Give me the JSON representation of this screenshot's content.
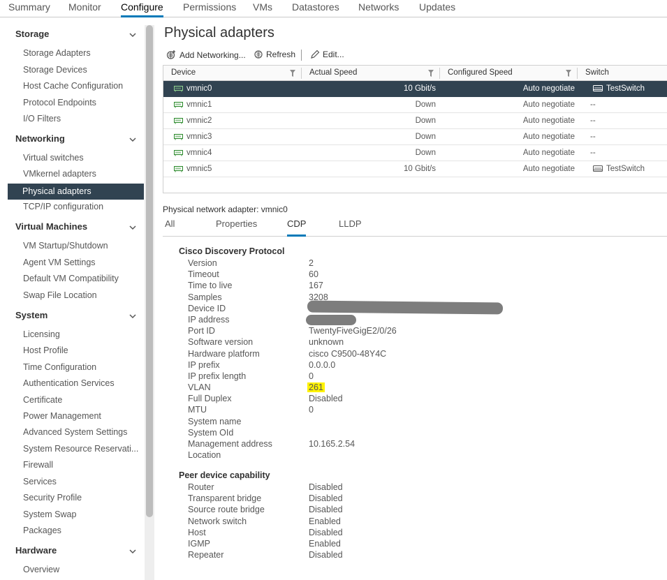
{
  "top_tabs": [
    "Summary",
    "Monitor",
    "Configure",
    "Permissions",
    "VMs",
    "Datastores",
    "Networks",
    "Updates"
  ],
  "sidebar": {
    "sections": [
      {
        "title": "Storage",
        "items": [
          "Storage Adapters",
          "Storage Devices",
          "Host Cache Configuration",
          "Protocol Endpoints",
          "I/O Filters"
        ]
      },
      {
        "title": "Networking",
        "items": [
          "Virtual switches",
          "VMkernel adapters",
          "Physical adapters",
          "TCP/IP configuration"
        ]
      },
      {
        "title": "Virtual Machines",
        "items": [
          "VM Startup/Shutdown",
          "Agent VM Settings",
          "Default VM Compatibility",
          "Swap File Location"
        ]
      },
      {
        "title": "System",
        "items": [
          "Licensing",
          "Host Profile",
          "Time Configuration",
          "Authentication Services",
          "Certificate",
          "Power Management",
          "Advanced System Settings",
          "System Resource Reservati...",
          "Firewall",
          "Services",
          "Security Profile",
          "System Swap",
          "Packages"
        ]
      },
      {
        "title": "Hardware",
        "items": [
          "Overview"
        ]
      }
    ],
    "active_item": "Physical adapters"
  },
  "main": {
    "title": "Physical adapters",
    "toolbar": {
      "add": "Add Networking...",
      "refresh": "Refresh",
      "edit": "Edit..."
    },
    "grid": {
      "columns": [
        "Device",
        "Actual Speed",
        "Configured Speed",
        "Switch"
      ],
      "rows": [
        {
          "device": "vmnic0",
          "actual": "10 Gbit/s",
          "configured": "Auto negotiate",
          "switch": "TestSwitch",
          "has_switch": true,
          "selected": true
        },
        {
          "device": "vmnic1",
          "actual": "Down",
          "configured": "Auto negotiate",
          "switch": "--",
          "has_switch": false,
          "selected": false
        },
        {
          "device": "vmnic2",
          "actual": "Down",
          "configured": "Auto negotiate",
          "switch": "--",
          "has_switch": false,
          "selected": false
        },
        {
          "device": "vmnic3",
          "actual": "Down",
          "configured": "Auto negotiate",
          "switch": "--",
          "has_switch": false,
          "selected": false
        },
        {
          "device": "vmnic4",
          "actual": "Down",
          "configured": "Auto negotiate",
          "switch": "--",
          "has_switch": false,
          "selected": false
        },
        {
          "device": "vmnic5",
          "actual": "10 Gbit/s",
          "configured": "Auto negotiate",
          "switch": "TestSwitch",
          "has_switch": true,
          "selected": false
        }
      ]
    },
    "detail_title": "Physical network adapter: vmnic0",
    "sub_tabs": [
      "All",
      "Properties",
      "CDP",
      "LLDP"
    ],
    "active_sub_tab": "CDP",
    "cdp": {
      "title": "Cisco Discovery Protocol",
      "fields": [
        {
          "key": "Version",
          "value": "2"
        },
        {
          "key": "Timeout",
          "value": "60"
        },
        {
          "key": "Time to live",
          "value": "167"
        },
        {
          "key": "Samples",
          "value": "3208"
        },
        {
          "key": "Device ID",
          "value": ""
        },
        {
          "key": "IP address",
          "value": ""
        },
        {
          "key": "Port ID",
          "value": "TwentyFiveGigE2/0/26"
        },
        {
          "key": "Software version",
          "value": "unknown"
        },
        {
          "key": "Hardware platform",
          "value": "cisco C9500-48Y4C"
        },
        {
          "key": "IP prefix",
          "value": "0.0.0.0"
        },
        {
          "key": "IP prefix length",
          "value": "0"
        },
        {
          "key": "VLAN",
          "value": "261",
          "highlight": true
        },
        {
          "key": "Full Duplex",
          "value": "Disabled"
        },
        {
          "key": "MTU",
          "value": "0"
        },
        {
          "key": "System name",
          "value": ""
        },
        {
          "key": "System OId",
          "value": ""
        },
        {
          "key": "Management address",
          "value": "10.165.2.54"
        },
        {
          "key": "Location",
          "value": ""
        }
      ]
    },
    "peer": {
      "title": "Peer device capability",
      "fields": [
        {
          "key": "Router",
          "value": "Disabled"
        },
        {
          "key": "Transparent bridge",
          "value": "Disabled"
        },
        {
          "key": "Source route bridge",
          "value": "Disabled"
        },
        {
          "key": "Network switch",
          "value": "Enabled"
        },
        {
          "key": "Host",
          "value": "Disabled"
        },
        {
          "key": "IGMP",
          "value": "Enabled"
        },
        {
          "key": "Repeater",
          "value": "Disabled"
        }
      ]
    }
  },
  "colors": {
    "accent": "#0079b8",
    "selected_bg": "#314351",
    "highlight": "#fff200",
    "nic_icon": "#2e8b2e"
  }
}
